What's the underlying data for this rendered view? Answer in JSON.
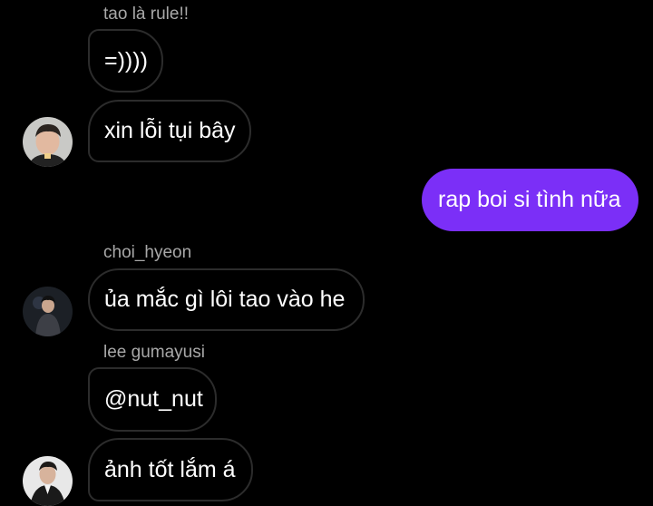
{
  "theme": {
    "background": "#000000",
    "incoming_border": "#2c2c2c",
    "outgoing_bubble": "#7b2ff7",
    "sender_name_color": "#a8a8a8"
  },
  "messages": [
    {
      "sender": "tao là rule!!",
      "text": "=))))"
    },
    {
      "text": "xin lỗi tụi bây",
      "avatar": "avatar-icon"
    },
    {
      "text": "rap boi si tình nữa",
      "outgoing": true
    },
    {
      "sender": "choi_hyeon",
      "text": "ủa mắc gì lôi tao vào he",
      "avatar": "avatar-icon"
    },
    {
      "sender": "lee gumayusi",
      "text": "@nut_nut"
    },
    {
      "text": "ảnh tốt lắm á",
      "avatar": "avatar-icon"
    }
  ]
}
